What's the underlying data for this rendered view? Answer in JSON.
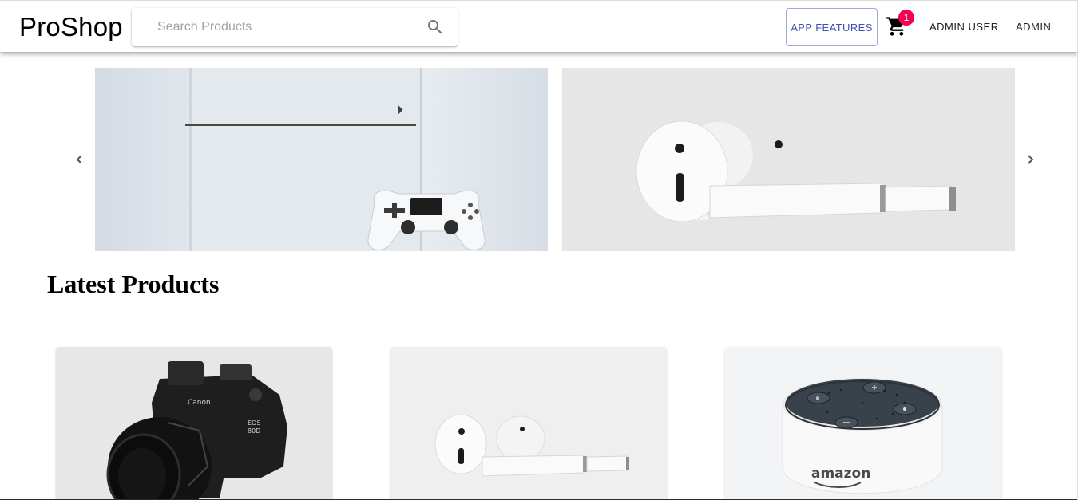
{
  "header": {
    "brand": "ProShop",
    "search": {
      "placeholder": "Search Products",
      "value": ""
    },
    "features_button": "App Features",
    "cart": {
      "count": "1",
      "icon": "cart-icon"
    },
    "user_menu": "Admin User",
    "admin_menu": "Admin"
  },
  "carousel": {
    "prev_icon": "chevron-left-icon",
    "next_icon": "chevron-right-icon",
    "slides": [
      {
        "product": "playstation"
      },
      {
        "product": "airpods"
      }
    ]
  },
  "main": {
    "section_title": "Latest Products",
    "products": [
      {
        "product": "camera"
      },
      {
        "product": "airpods"
      },
      {
        "product": "echo-dot",
        "brand_mark": "amazon"
      }
    ]
  },
  "colors": {
    "accent": "#3f51b5",
    "badge": "#f50057",
    "text": "#000000"
  }
}
